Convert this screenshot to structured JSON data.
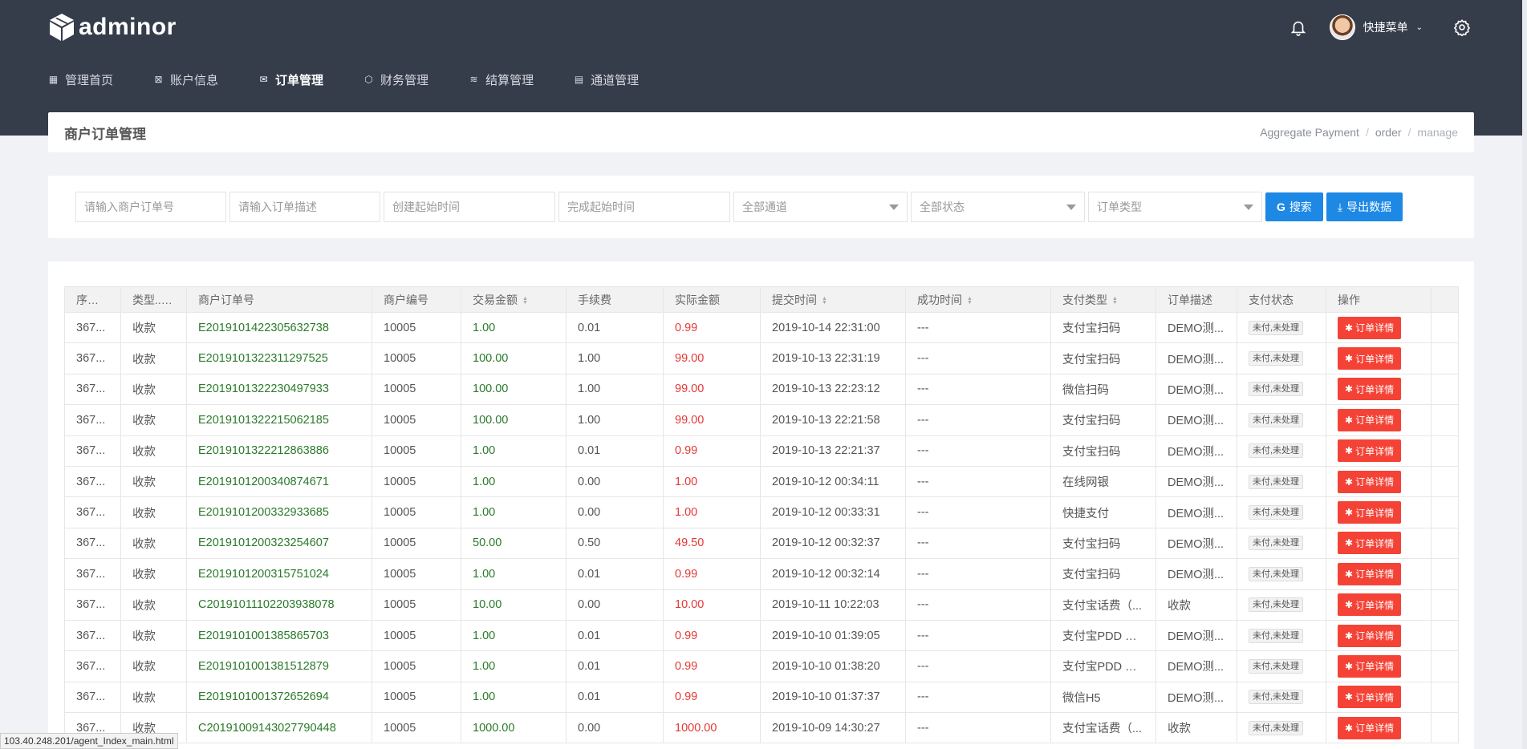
{
  "brand": {
    "name": "adminor"
  },
  "user": {
    "menu_label": "快捷菜单"
  },
  "nav": {
    "items": [
      {
        "label": "管理首页",
        "icon": "▦",
        "active": false
      },
      {
        "label": "账户信息",
        "icon": "⊠",
        "active": false
      },
      {
        "label": "订单管理",
        "icon": "✉",
        "active": true
      },
      {
        "label": "财务管理",
        "icon": "⬡",
        "active": false
      },
      {
        "label": "结算管理",
        "icon": "≋",
        "active": false
      },
      {
        "label": "通道管理",
        "icon": "▤",
        "active": false
      }
    ]
  },
  "page": {
    "title": "商户订单管理",
    "breadcrumb": [
      "Aggregate Payment",
      "order",
      "manage"
    ]
  },
  "filters": {
    "order_no_placeholder": "请输入商户订单号",
    "desc_placeholder": "请输入订单描述",
    "create_time_placeholder": "创建起始时间",
    "finish_time_placeholder": "完成起始时间",
    "channel": "全部通道",
    "status": "全部状态",
    "type": "订单类型",
    "search_label": "搜索",
    "export_label": "导出数据"
  },
  "table": {
    "headers": [
      "序号...",
      "类型...",
      "商户订单号",
      "商户编号",
      "交易金额",
      "手续费",
      "实际金额",
      "提交时间",
      "成功时间",
      "支付类型",
      "订单描述",
      "支付状态",
      "操作"
    ],
    "action_label": "订单详情",
    "rows": [
      [
        "367...",
        "收款",
        "E20191014223056327 38",
        "10005",
        "1.00",
        "0.01",
        "0.99",
        "2019-10-14 22:31:00",
        "---",
        "支付宝扫码",
        "DEMO测...",
        "未付,未处理"
      ],
      [
        "367...",
        "收款",
        "E20191013223112975 25",
        "10005",
        "100.00",
        "1.00",
        "99.00",
        "2019-10-13 22:31:19",
        "---",
        "支付宝扫码",
        "DEMO测...",
        "未付,未处理"
      ],
      [
        "367...",
        "收款",
        "E20191013222304979 33",
        "10005",
        "100.00",
        "1.00",
        "99.00",
        "2019-10-13 22:23:12",
        "---",
        "微信扫码",
        "DEMO测...",
        "未付,未处理"
      ],
      [
        "367...",
        "收款",
        "E20191013222150621 85",
        "10005",
        "100.00",
        "1.00",
        "99.00",
        "2019-10-13 22:21:58",
        "---",
        "支付宝扫码",
        "DEMO测...",
        "未付,未处理"
      ],
      [
        "367...",
        "收款",
        "E20191013222128638 86",
        "10005",
        "1.00",
        "0.01",
        "0.99",
        "2019-10-13 22:21:37",
        "---",
        "支付宝扫码",
        "DEMO测...",
        "未付,未处理"
      ],
      [
        "367...",
        "收款",
        "E20191012003408746 71",
        "10005",
        "1.00",
        "0.00",
        "1.00",
        "2019-10-12 00:34:11",
        "---",
        "在线网银",
        "DEMO测...",
        "未付,未处理"
      ],
      [
        "367...",
        "收款",
        "E20191012003329336 85",
        "10005",
        "1.00",
        "0.00",
        "1.00",
        "2019-10-12 00:33:31",
        "---",
        "快捷支付",
        "DEMO测...",
        "未付,未处理"
      ],
      [
        "367...",
        "收款",
        "E20191012003232546 07",
        "10005",
        "50.00",
        "0.50",
        "49.50",
        "2019-10-12 00:32:37",
        "---",
        "支付宝扫码",
        "DEMO测...",
        "未付,未处理"
      ],
      [
        "367...",
        "收款",
        "E20191012003157510 24",
        "10005",
        "1.00",
        "0.01",
        "0.99",
        "2019-10-12 00:32:14",
        "---",
        "支付宝扫码",
        "DEMO测...",
        "未付,未处理"
      ],
      [
        "367...",
        "收款",
        "C20191011102203938 078",
        "10005",
        "10.00",
        "0.00",
        "10.00",
        "2019-10-11 10:22:03",
        "---",
        "支付宝话费（...",
        "收款",
        "未付,未处理"
      ],
      [
        "367...",
        "收款",
        "E20191010013858657 03",
        "10005",
        "1.00",
        "0.01",
        "0.99",
        "2019-10-10 01:39:05",
        "---",
        "支付宝PDD 单...",
        "DEMO测...",
        "未付,未处理"
      ],
      [
        "367...",
        "收款",
        "E20191010013815128 79",
        "10005",
        "1.00",
        "0.01",
        "0.99",
        "2019-10-10 01:38:20",
        "---",
        "支付宝PDD 单...",
        "DEMO测...",
        "未付,未处理"
      ],
      [
        "367...",
        "收款",
        "E20191010013726526 94",
        "10005",
        "1.00",
        "0.01",
        "0.99",
        "2019-10-10 01:37:37",
        "---",
        "微信H5",
        "DEMO测...",
        "未付,未处理"
      ],
      [
        "367...",
        "收款",
        "C20191009143027790 448",
        "10005",
        "1000.00",
        "0.00",
        "1000.00",
        "2019-10-09 14:30:27",
        "---",
        "支付宝话费（...",
        "收款",
        "未付,未处理"
      ]
    ]
  },
  "statusbar": {
    "url": "103.40.248.201/agent_Index_main.html"
  }
}
